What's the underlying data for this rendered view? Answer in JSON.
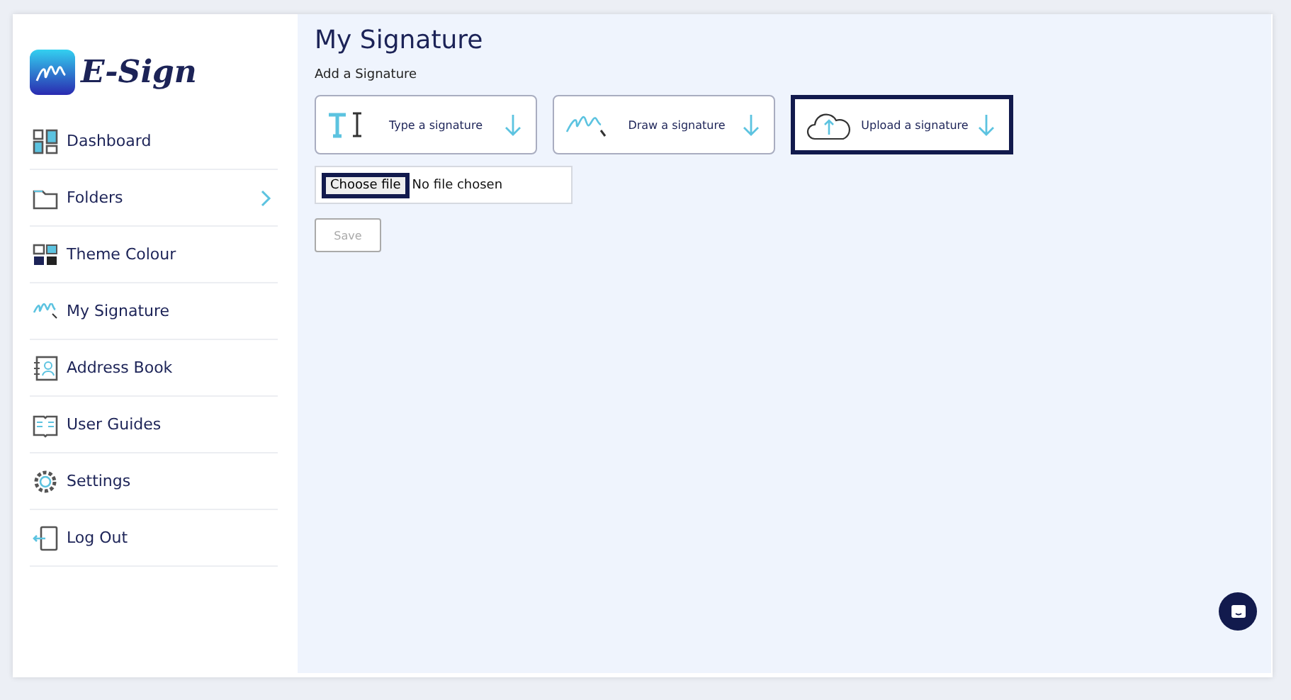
{
  "logo": {
    "text": "E-Sign"
  },
  "sidebar": {
    "items": [
      {
        "label": "Dashboard",
        "kind": "dashboard",
        "expandable": false
      },
      {
        "label": "Folders",
        "kind": "folder",
        "expandable": true
      },
      {
        "label": "Theme Colour",
        "kind": "theme",
        "expandable": false
      },
      {
        "label": "My Signature",
        "kind": "signature",
        "expandable": false
      },
      {
        "label": "Address Book",
        "kind": "address",
        "expandable": false
      },
      {
        "label": "User Guides",
        "kind": "guide",
        "expandable": false
      },
      {
        "label": "Settings",
        "kind": "settings",
        "expandable": false
      },
      {
        "label": "Log Out",
        "kind": "logout",
        "expandable": false
      }
    ]
  },
  "main": {
    "title": "My Signature",
    "subtitle": "Add a Signature",
    "options": [
      {
        "label": "Type a signature",
        "kind": "type",
        "selected": false
      },
      {
        "label": "Draw a signature",
        "kind": "draw",
        "selected": false
      },
      {
        "label": "Upload a signature",
        "kind": "upload",
        "selected": true
      }
    ],
    "file_input": {
      "button": "Choose file",
      "value": "No file chosen"
    },
    "save_button": {
      "label": "Save",
      "disabled": true
    }
  }
}
